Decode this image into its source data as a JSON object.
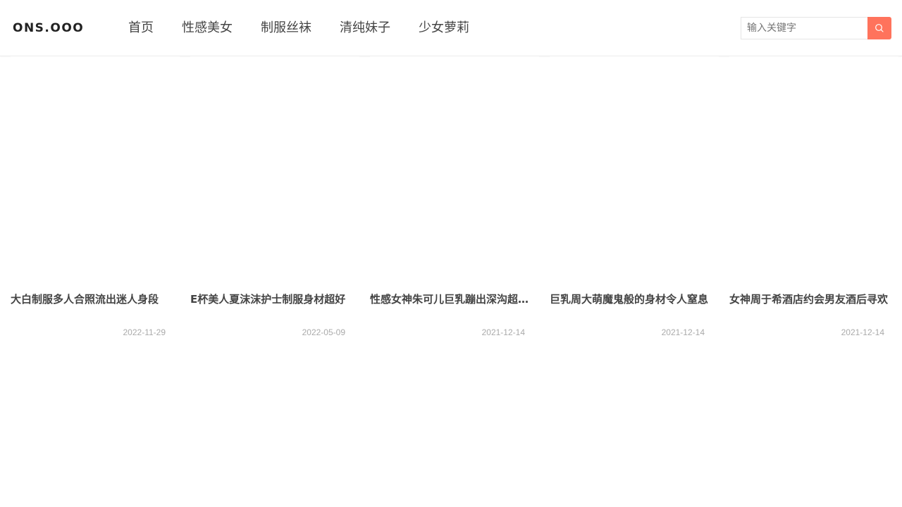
{
  "site": {
    "logo": "ONS.OOO"
  },
  "nav": {
    "items": [
      {
        "label": "首页"
      },
      {
        "label": "性感美女"
      },
      {
        "label": "制服丝袜"
      },
      {
        "label": "清纯妹子"
      },
      {
        "label": "少女萝莉"
      }
    ]
  },
  "search": {
    "placeholder": "输入关键字",
    "value": "",
    "button_icon": "search-icon",
    "accent_color": "#ff735c"
  },
  "posts": [
    {
      "title": "大白制服多人合照流出迷人身段",
      "date": "2022-11-29"
    },
    {
      "title": "E杯美人夏沫沫护士制服身材超好",
      "date": "2022-05-09"
    },
    {
      "title": "性感女神朱可儿巨乳蹦出深沟超级诱人",
      "date": "2021-12-14"
    },
    {
      "title": "巨乳周大萌魔鬼般的身材令人窒息",
      "date": "2021-12-14"
    },
    {
      "title": "女神周于希酒店约会男友酒后寻欢",
      "date": "2021-12-14"
    }
  ]
}
